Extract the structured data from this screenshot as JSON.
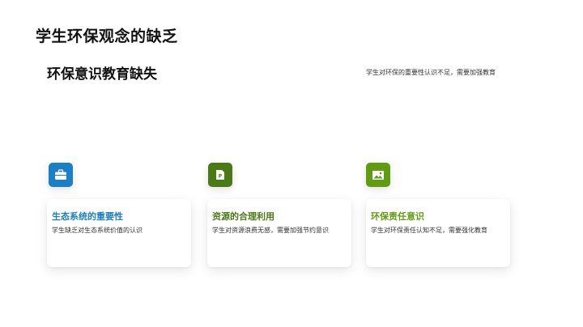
{
  "slide": {
    "title": "学生环保观念的缺乏",
    "section_title": "环保意识教育缺失",
    "section_desc": "学生对环保的重要性认识不足，需要加强教育"
  },
  "cards": [
    {
      "icon": "briefcase-icon",
      "color": "#1a7fc4",
      "title": "生态系统的重要性",
      "text": "学生缺乏对生态系统价值的认识"
    },
    {
      "icon": "document-icon",
      "color": "#4a7a16",
      "title": "资源的合理利用",
      "text": "学生对资源浪费无感，需要加强节约意识"
    },
    {
      "icon": "image-icon",
      "color": "#5f9c12",
      "title": "环保责任意识",
      "text": "学生对环保责任认知不足，需要强化教育"
    }
  ]
}
